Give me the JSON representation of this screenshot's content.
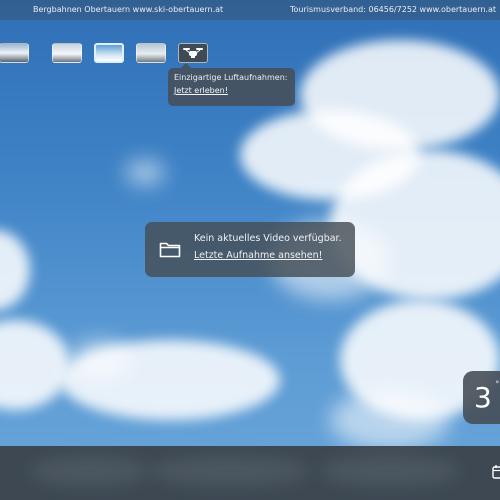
{
  "topbar": {
    "left_text": "Bergbahnen Obertauern www.ski-obertauern.at",
    "right_text": "Tourismusverband: 06456/7252 www.obertauern.at"
  },
  "thumbnails": [
    {
      "icon": "webcam-thumbnail"
    },
    {
      "icon": "webcam-thumbnail"
    },
    {
      "icon": "webcam-thumbnail",
      "selected": true
    },
    {
      "icon": "webcam-thumbnail"
    },
    {
      "icon": "drone-icon"
    }
  ],
  "tooltip": {
    "line1": "Einzigartige Luftaufnahmen:",
    "link": "Jetzt erleben!"
  },
  "message": {
    "icon": "folder-icon",
    "text": "Kein aktuelles Video verfügbar.",
    "link": "Letzte Aufnahme ansehen!"
  },
  "temperature": {
    "value": "3",
    "unit": "°"
  },
  "bottombar": {
    "icon": "calendar-icon"
  },
  "colors": {
    "panel": "#464e56",
    "sky": "#3f83c6"
  }
}
